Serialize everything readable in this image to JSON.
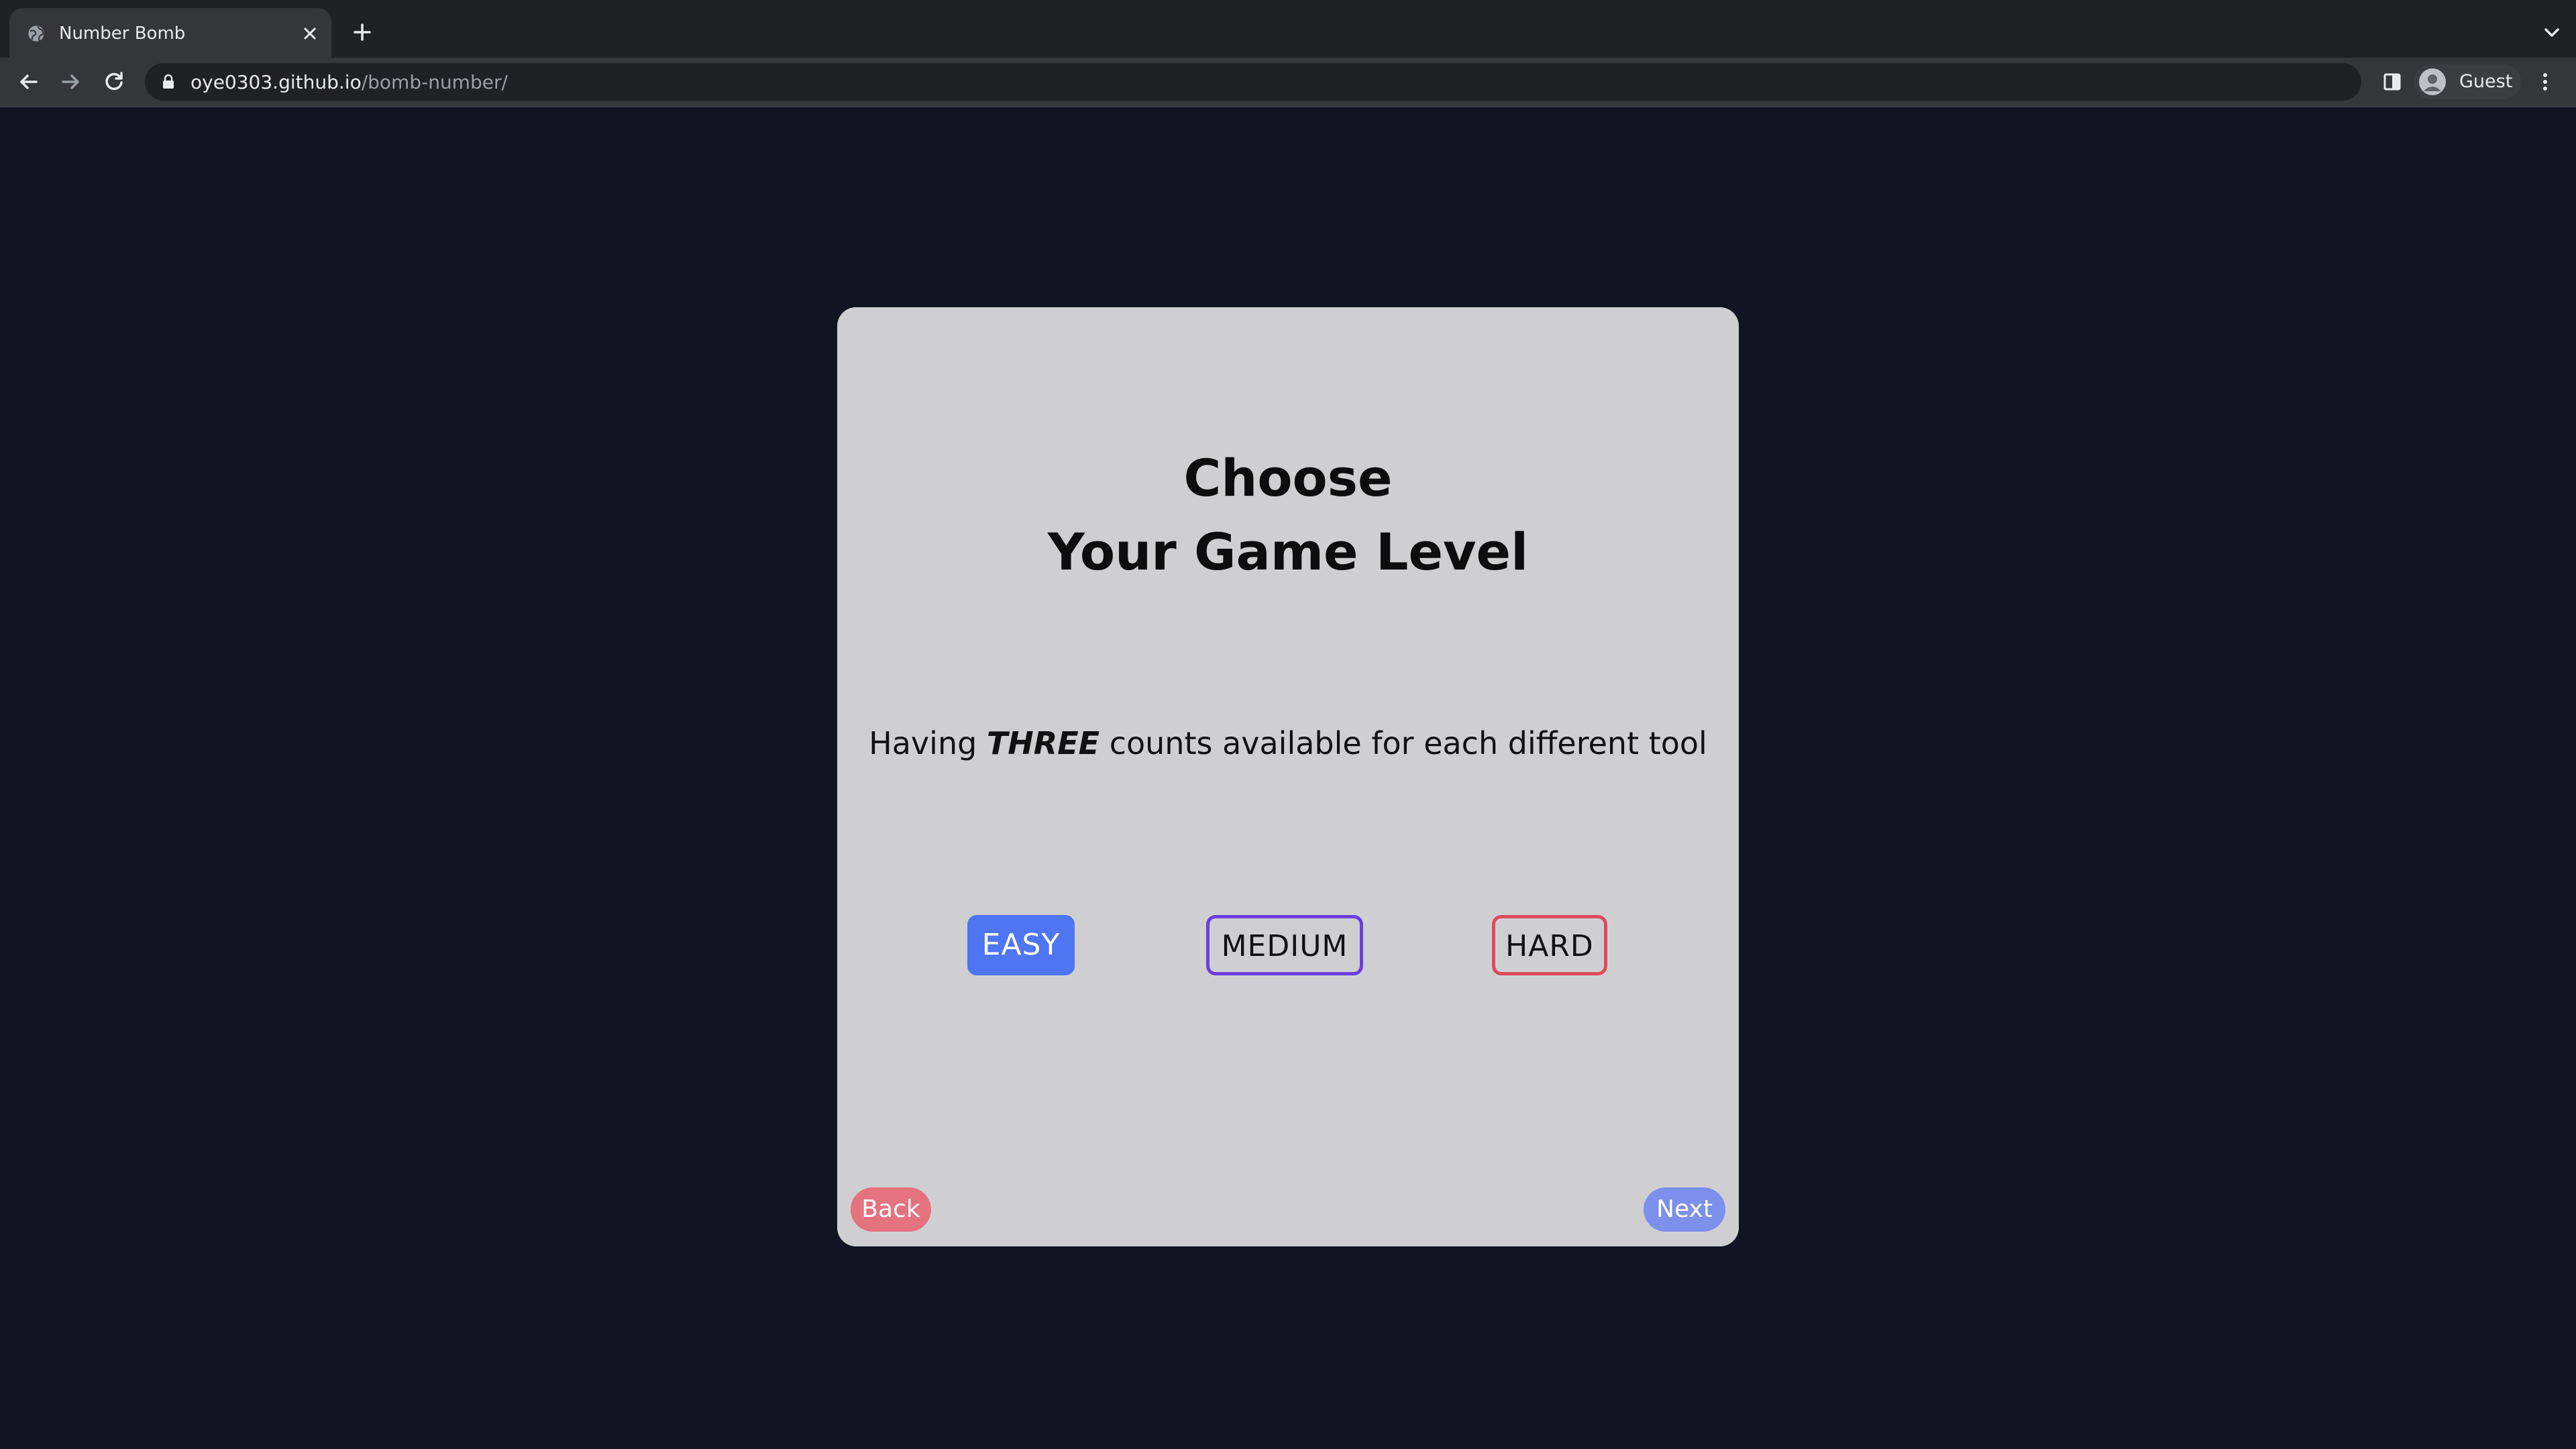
{
  "browser": {
    "tab_title": "Number Bomb",
    "url_host": "oye0303.github.io",
    "url_path": "/bomb-number/",
    "profile_label": "Guest"
  },
  "page": {
    "heading_line1": "Choose",
    "heading_line2": "Your Game Level",
    "desc_prefix": "Having ",
    "desc_emphasis": "THREE",
    "desc_suffix": " counts available for each different tool",
    "levels": [
      {
        "label": "EASY",
        "selected": true
      },
      {
        "label": "MEDIUM",
        "selected": false
      },
      {
        "label": "HARD",
        "selected": false
      }
    ],
    "back_label": "Back",
    "next_label": "Next"
  },
  "colors": {
    "background": "#121424",
    "card": "#cfcfd2",
    "easy": "#4e75f2",
    "medium_border": "#6b3fdd",
    "hard_border": "#dd4b5c",
    "back": "#e4727f",
    "next": "#7c90ec"
  }
}
